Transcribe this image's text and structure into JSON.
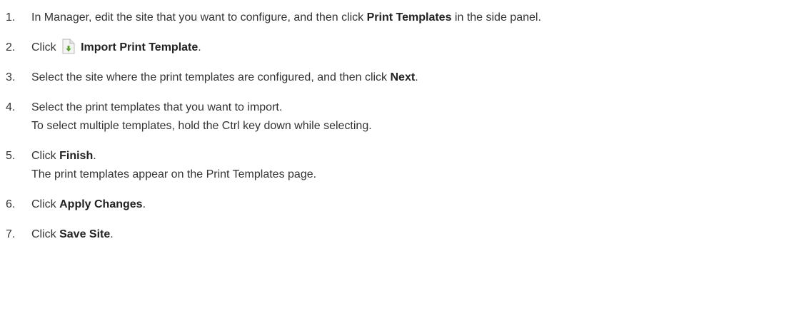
{
  "steps": [
    {
      "num": "1.",
      "parts": [
        "In Manager, edit the site that you want to configure, and then click ",
        "Print Templates",
        " in the side panel."
      ]
    },
    {
      "num": "2.",
      "parts": [
        "Click ",
        "Import Print Template",
        "."
      ],
      "icon": "import-document-icon"
    },
    {
      "num": "3.",
      "parts": [
        "Select the site where the print templates are configured, and then click ",
        "Next",
        "."
      ]
    },
    {
      "num": "4.",
      "line1": "Select the print templates that you want to import.",
      "line2": "To select multiple templates, hold the Ctrl key down while selecting."
    },
    {
      "num": "5.",
      "parts": [
        "Click ",
        "Finish",
        "."
      ],
      "line2": "The print templates appear on the Print Templates page."
    },
    {
      "num": "6.",
      "parts": [
        "Click ",
        "Apply Changes",
        "."
      ]
    },
    {
      "num": "7.",
      "parts": [
        "Click ",
        "Save Site",
        "."
      ]
    }
  ],
  "colors": {
    "text": "#333333",
    "icon_page": "#f2f2f2",
    "icon_arrow": "#5aa02c"
  }
}
